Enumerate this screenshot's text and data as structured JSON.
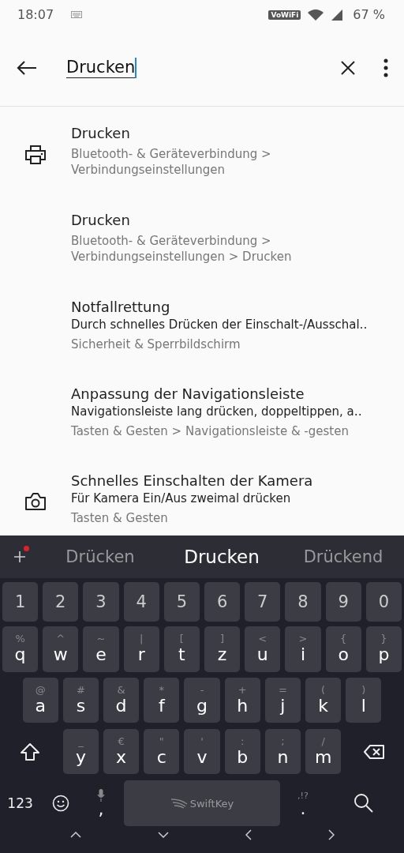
{
  "status_bar": {
    "time": "18:07",
    "wifi_call": "VoWiFi",
    "battery": "67 %"
  },
  "search": {
    "value": "Drucken"
  },
  "results": [
    {
      "title": "Drucken",
      "path": "Bluetooth- & Geräteverbindung > Verbindungseinstellungen"
    },
    {
      "title": "Drucken",
      "path": "Bluetooth- & Geräteverbindung > Verbindungseinstellungen > Drucken"
    },
    {
      "title": "Notfallrettung",
      "summary": "Durch schnelles Drücken der Einschalt-/Ausschal‥",
      "path": "Sicherheit & Sperrbildschirm"
    },
    {
      "title": "Anpassung der Navigationsleiste",
      "summary": "Navigationsleiste lang drücken, doppeltippen, a‥",
      "path": "Tasten & Gesten > Navigationsleiste & -gesten"
    },
    {
      "title": "Schnelles Einschalten der Kamera",
      "summary": "Für Kamera Ein/Aus zweimal drücken",
      "path": "Tasten & Gesten"
    }
  ],
  "keyboard": {
    "suggestions": [
      {
        "text": "Drücken",
        "selected": false
      },
      {
        "text": "Drucken",
        "selected": true
      },
      {
        "text": "Drückend",
        "selected": false
      }
    ],
    "number_row": [
      "1",
      "2",
      "3",
      "4",
      "5",
      "6",
      "7",
      "8",
      "9",
      "0"
    ],
    "letter_rows": [
      [
        {
          "main": "q",
          "alt": "%"
        },
        {
          "main": "w",
          "alt": "^"
        },
        {
          "main": "e",
          "alt": "~"
        },
        {
          "main": "r",
          "alt": "|"
        },
        {
          "main": "t",
          "alt": "["
        },
        {
          "main": "z",
          "alt": "]"
        },
        {
          "main": "u",
          "alt": "<"
        },
        {
          "main": "i",
          "alt": ">"
        },
        {
          "main": "o",
          "alt": "{"
        },
        {
          "main": "p",
          "alt": "}"
        }
      ],
      [
        {
          "main": "a",
          "alt": "@"
        },
        {
          "main": "s",
          "alt": "#"
        },
        {
          "main": "d",
          "alt": "&"
        },
        {
          "main": "f",
          "alt": "*"
        },
        {
          "main": "g",
          "alt": "-"
        },
        {
          "main": "h",
          "alt": "+"
        },
        {
          "main": "j",
          "alt": "="
        },
        {
          "main": "k",
          "alt": "("
        },
        {
          "main": "l",
          "alt": ")"
        }
      ],
      [
        {
          "main": "y",
          "alt": "_"
        },
        {
          "main": "x",
          "alt": "€"
        },
        {
          "main": "c",
          "alt": "\""
        },
        {
          "main": "v",
          "alt": "'"
        },
        {
          "main": "b",
          "alt": ":"
        },
        {
          "main": "n",
          "alt": ";"
        },
        {
          "main": "m",
          "alt": "/"
        }
      ]
    ],
    "symbols_key": "123",
    "comma_key": ",",
    "space_label": "SwiftKey",
    "period_key": ".",
    "period_alt": ",!?"
  }
}
